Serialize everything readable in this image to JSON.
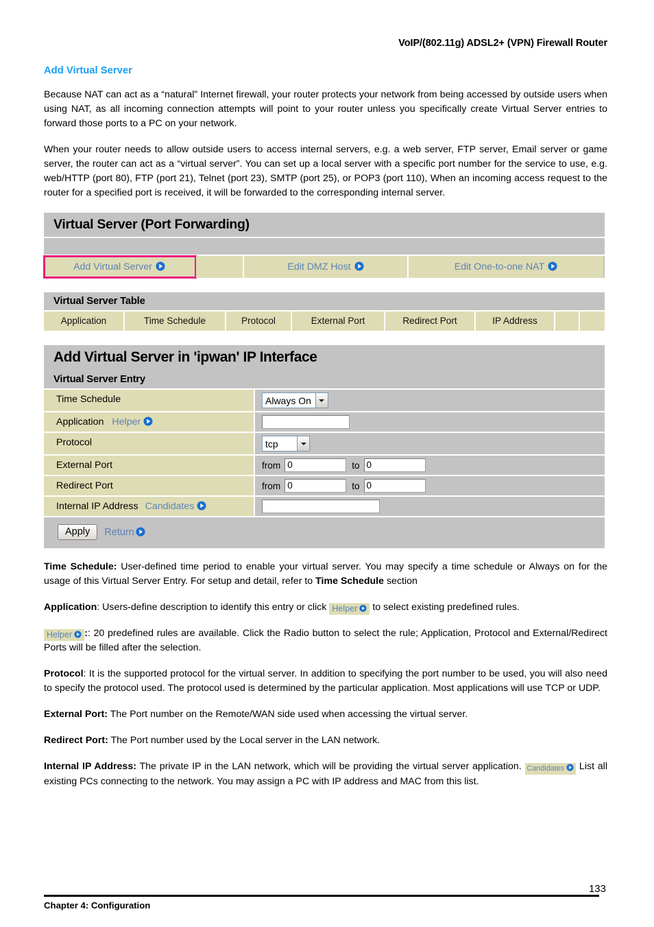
{
  "header": {
    "running_title": "VoIP/(802.11g) ADSL2+ (VPN) Firewall Router"
  },
  "section": {
    "heading": "Add Virtual Server",
    "paragraph_1": "Because NAT can act as a “natural” Internet firewall, your router protects your network from being accessed by outside users when using NAT, as all incoming connection attempts will point to your router unless you specifically create Virtual Server entries to forward those ports to a PC on your network.",
    "paragraph_2": "When your router needs to allow outside users to access internal servers, e.g. a web server, FTP server, Email server or game server, the router can act as a “virtual server”. You can set up a local server with a specific port number for the service to use, e.g. web/HTTP (port 80), FTP (port 21), Telnet (port 23), SMTP (port 25), or POP3 (port 110), When an incoming access request to the router for a specified port is received, it will be forwarded to the corresponding internal server."
  },
  "ui": {
    "panel_title": "Virtual Server (Port Forwarding)",
    "links": [
      {
        "label": "Add Virtual Server",
        "icon": "arrow-right-circle-icon",
        "highlighted": true
      },
      {
        "label": "Edit DMZ Host",
        "icon": "arrow-right-circle-icon",
        "highlighted": false
      },
      {
        "label": "Edit One-to-one NAT",
        "icon": "arrow-right-circle-icon",
        "highlighted": false
      }
    ],
    "table": {
      "title": "Virtual Server Table",
      "columns": [
        "Application",
        "Time Schedule",
        "Protocol",
        "External Port",
        "Redirect Port",
        "IP Address",
        "",
        ""
      ],
      "rows": []
    },
    "form": {
      "title": "Add Virtual Server in 'ipwan' IP Interface",
      "subtitle": "Virtual Server Entry",
      "time_schedule": {
        "label": "Time Schedule",
        "value": "Always On"
      },
      "application": {
        "label": "Application",
        "helper_label": "Helper",
        "value": "",
        "placeholder": ""
      },
      "protocol": {
        "label": "Protocol",
        "value": "tcp"
      },
      "external_port": {
        "label": "External Port",
        "from_label": "from",
        "from_value": "0",
        "to_label": "to",
        "to_value": "0"
      },
      "redirect_port": {
        "label": "Redirect Port",
        "from_label": "from",
        "from_value": "0",
        "to_label": "to",
        "to_value": "0"
      },
      "internal_ip": {
        "label": "Internal IP Address",
        "candidates_label": "Candidates",
        "value": "",
        "placeholder": ""
      },
      "apply_label": "Apply",
      "return_label": "Return"
    }
  },
  "descriptions": {
    "time_schedule": {
      "term": "Time Schedule:",
      "text_1": " User-defined time period to enable your virtual server.  You may specify a time schedule or Always on for the usage of this Virtual Server Entry.  For setup and detail, refer to ",
      "term_2": "Time Schedule",
      "text_2": " section"
    },
    "application": {
      "term": "Application",
      "text_1": ": Users-define description to identify this entry or click ",
      "chip": "Helper",
      "text_2": " to select existing predefined rules."
    },
    "helper": {
      "chip": "Helper",
      "text": ": 20 predefined rules are available.  Click the Radio button to select the rule; Application, Protocol and External/Redirect Ports will be filled after the selection."
    },
    "protocol": {
      "term": "Protocol",
      "text": ": It is the supported protocol for the virtual server. In addition to specifying the port number to be used, you will also need to specify the protocol used. The protocol used is determined by the particular application. Most applications will use TCP or UDP."
    },
    "external_port": {
      "term": "External Port:",
      "text": " The Port number on the Remote/WAN side used when accessing the virtual server."
    },
    "redirect_port": {
      "term": "Redirect Port:",
      "text": " The Port number used by the Local server in the LAN network."
    },
    "internal_ip": {
      "term": "Internal IP Address:",
      "text_1": " The private IP in the LAN network, which will be providing the virtual server application. ",
      "chip": "Candidates",
      "text_2": " List all existing PCs connecting to the network. You may assign a PC with IP address and MAC from this list."
    }
  },
  "footer": {
    "page_number": "133",
    "chapter": "Chapter 4: Configuration"
  },
  "colors": {
    "heading_blue": "#1a9ef5",
    "link_blue": "#5d83b4",
    "panel_gray": "#c3c3c3",
    "row_tan": "#dedcb4",
    "highlight_magenta": "#ec1c7d",
    "icon_blue": "#1c6fd0"
  }
}
